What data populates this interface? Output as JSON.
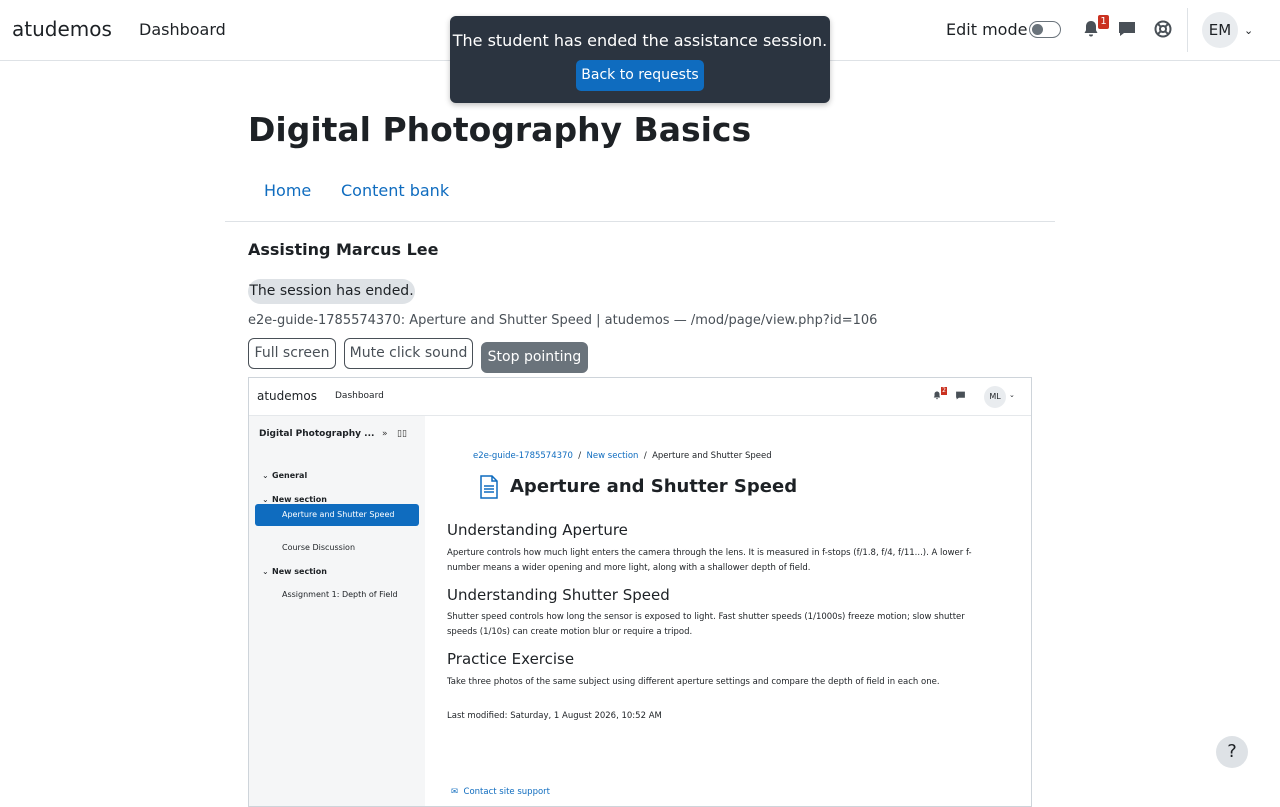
{
  "navbar": {
    "brand": "atudemos",
    "dashboard": "Dashboard",
    "edit_mode": "Edit mode",
    "notification_count": "1",
    "avatar_initials": "EM"
  },
  "toast": {
    "message": "The student has ended the assistance session.",
    "button": "Back to requests"
  },
  "page": {
    "title": "Digital Photography Basics",
    "secondary_nav": [
      "Home",
      "Content bank"
    ],
    "assisting": "Assisting Marcus Lee",
    "session_status": "The session has ended.",
    "session_info": "e2e-guide-1785574370: Aperture and Shutter Speed | atudemos — /mod/page/view.php?id=106",
    "controls": {
      "full_screen": "Full screen",
      "mute": "Mute click sound",
      "stop_pointing": "Stop pointing"
    }
  },
  "student_view": {
    "brand": "atudemos",
    "dashboard": "Dashboard",
    "notification_count": "2",
    "avatar_initials": "ML",
    "course_name": "Digital Photography ...",
    "sections": [
      {
        "label": "General"
      },
      {
        "label": "New section",
        "items": [
          "Aperture and Shutter Speed",
          "Course Discussion"
        ]
      },
      {
        "label": "New section",
        "items": [
          "Assignment 1: Depth of Field"
        ]
      }
    ],
    "breadcrumb": [
      "e2e-guide-1785574370",
      "New section",
      "Aperture and Shutter Speed"
    ],
    "breadcrumb_sep": "/",
    "title": "Aperture and Shutter Speed",
    "content": [
      {
        "heading": "Understanding Aperture",
        "text": "Aperture controls how much light enters the camera through the lens. It is measured in f-stops (f/1.8, f/4, f/11...). A lower f-number means a wider opening and more light, along with a shallower depth of field."
      },
      {
        "heading": "Understanding Shutter Speed",
        "text": "Shutter speed controls how long the sensor is exposed to light. Fast shutter speeds (1/1000s) freeze motion; slow shutter speeds (1/10s) can create motion blur or require a tripod."
      },
      {
        "heading": "Practice Exercise",
        "text": "Take three photos of the same subject using different aperture settings and compare the depth of field in each one."
      }
    ],
    "last_modified": "Last modified: Saturday, 1 August 2026, 10:52 AM",
    "support_link": "Contact site support"
  },
  "help_button": "?",
  "colors": {
    "primary": "#0f6cbf",
    "toast_bg": "#2b3440",
    "badge": "#ca3120"
  }
}
